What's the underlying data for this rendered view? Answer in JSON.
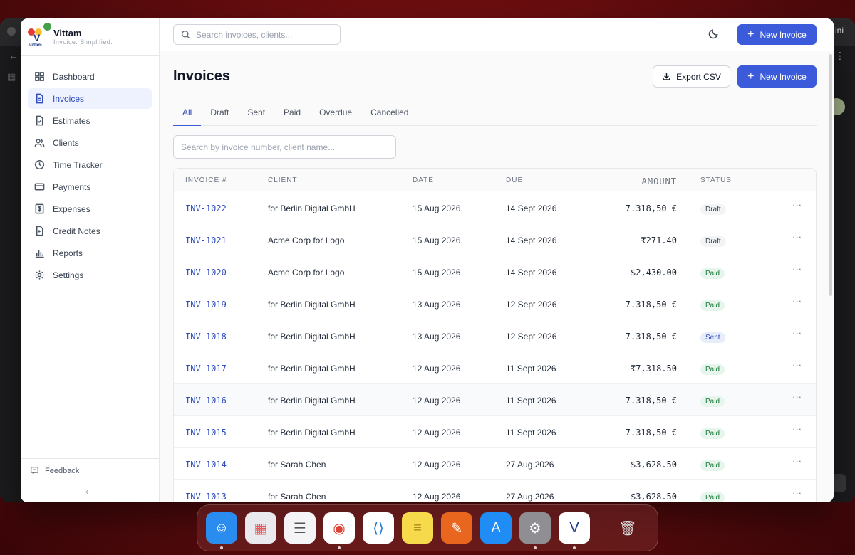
{
  "brand": {
    "name": "Vittam",
    "tagline": "Invoice. Simplified.",
    "logo_letter": "V",
    "logo_sub": "vittam"
  },
  "background": {
    "ini_text": "ini"
  },
  "sidebar": {
    "items": [
      {
        "label": "Dashboard",
        "icon": "dashboard-icon"
      },
      {
        "label": "Invoices",
        "icon": "document-icon",
        "active": true
      },
      {
        "label": "Estimates",
        "icon": "estimate-icon"
      },
      {
        "label": "Clients",
        "icon": "users-icon"
      },
      {
        "label": "Time Tracker",
        "icon": "clock-icon"
      },
      {
        "label": "Payments",
        "icon": "card-icon"
      },
      {
        "label": "Expenses",
        "icon": "dollar-icon"
      },
      {
        "label": "Credit Notes",
        "icon": "credit-note-icon"
      },
      {
        "label": "Reports",
        "icon": "bar-chart-icon"
      },
      {
        "label": "Settings",
        "icon": "gear-icon"
      }
    ],
    "feedback_label": "Feedback",
    "collapse_glyph": "‹"
  },
  "topbar": {
    "search_placeholder": "Search invoices, clients...",
    "new_invoice_label": "New Invoice"
  },
  "page": {
    "title": "Invoices",
    "export_label": "Export CSV",
    "new_invoice_label": "New Invoice",
    "tabs": [
      "All",
      "Draft",
      "Sent",
      "Paid",
      "Overdue",
      "Cancelled"
    ],
    "active_tab": "All",
    "table_search_placeholder": "Search by invoice number, client name..."
  },
  "table": {
    "headers": {
      "number": "INVOICE #",
      "client": "CLIENT",
      "date": "DATE",
      "due": "DUE",
      "amount": "AMOUNT",
      "status": "STATUS"
    },
    "rows": [
      {
        "number": "INV-1022",
        "client": "for Berlin Digital GmbH",
        "date": "15 Aug 2026",
        "due": "14 Sept 2026",
        "amount": "7.318,50 €",
        "status": "Draft"
      },
      {
        "number": "INV-1021",
        "client": "Acme Corp for Logo",
        "date": "15 Aug 2026",
        "due": "14 Sept 2026",
        "amount": "₹271.40",
        "status": "Draft"
      },
      {
        "number": "INV-1020",
        "client": "Acme Corp for Logo",
        "date": "15 Aug 2026",
        "due": "14 Sept 2026",
        "amount": "$2,430.00",
        "status": "Paid"
      },
      {
        "number": "INV-1019",
        "client": "for Berlin Digital GmbH",
        "date": "13 Aug 2026",
        "due": "12 Sept 2026",
        "amount": "7.318,50 €",
        "status": "Paid"
      },
      {
        "number": "INV-1018",
        "client": "for Berlin Digital GmbH",
        "date": "13 Aug 2026",
        "due": "12 Sept 2026",
        "amount": "7.318,50 €",
        "status": "Sent"
      },
      {
        "number": "INV-1017",
        "client": "for Berlin Digital GmbH",
        "date": "12 Aug 2026",
        "due": "11 Sept 2026",
        "amount": "₹7,318.50",
        "status": "Paid"
      },
      {
        "number": "INV-1016",
        "client": "for Berlin Digital GmbH",
        "date": "12 Aug 2026",
        "due": "11 Sept 2026",
        "amount": "7.318,50 €",
        "status": "Paid"
      },
      {
        "number": "INV-1015",
        "client": "for Berlin Digital GmbH",
        "date": "12 Aug 2026",
        "due": "11 Sept 2026",
        "amount": "7.318,50 €",
        "status": "Paid"
      },
      {
        "number": "INV-1014",
        "client": "for Sarah Chen",
        "date": "12 Aug 2026",
        "due": "27 Aug 2026",
        "amount": "$3,628.50",
        "status": "Paid"
      },
      {
        "number": "INV-1013",
        "client": "for Sarah Chen",
        "date": "12 Aug 2026",
        "due": "27 Aug 2026",
        "amount": "$3,628.50",
        "status": "Paid"
      }
    ],
    "more_glyph": "···"
  },
  "colors": {
    "accent": "#3b5bdb",
    "paid_bg": "#e6f6ec",
    "sent_bg": "#e7edfb",
    "draft_bg": "#f3f4f6"
  },
  "dock": {
    "apps": [
      {
        "name": "Finder",
        "icon": "finder-icon",
        "color": "#2b8cf0",
        "running": true
      },
      {
        "name": "Launchpad",
        "icon": "launchpad-icon",
        "color": "#e9e9ee",
        "running": false
      },
      {
        "name": "Reminders",
        "icon": "reminders-icon",
        "color": "#f4f4f6",
        "running": false
      },
      {
        "name": "Chrome",
        "icon": "chrome-icon",
        "color": "#ffffff",
        "running": true
      },
      {
        "name": "VS Code",
        "icon": "vscode-icon",
        "color": "#ffffff",
        "running": false
      },
      {
        "name": "Notes",
        "icon": "notes-icon",
        "color": "#f7d94c",
        "running": false
      },
      {
        "name": "Pages",
        "icon": "pages-icon",
        "color": "#e9661e",
        "running": false
      },
      {
        "name": "App Store",
        "icon": "app-store-icon",
        "color": "#1f8df5",
        "running": false
      },
      {
        "name": "System Settings",
        "icon": "settings-icon",
        "color": "#8e8e93",
        "running": true
      },
      {
        "name": "Vittam",
        "icon": "vittam-app-icon",
        "color": "#ffffff",
        "running": true
      },
      {
        "name": "Trash",
        "icon": "trash-icon",
        "color": "transparent",
        "running": false
      }
    ]
  }
}
